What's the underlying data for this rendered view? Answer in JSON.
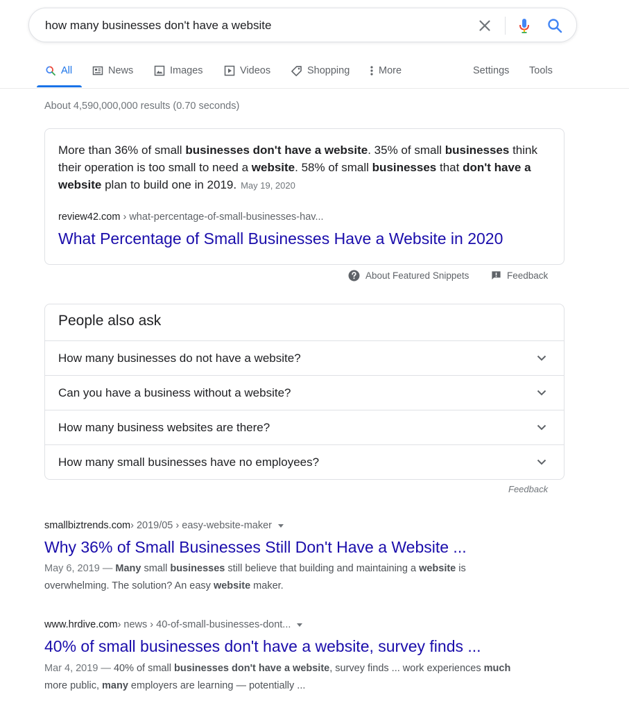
{
  "search": {
    "query": "how many businesses don't have a website"
  },
  "tabs": [
    {
      "label": "All",
      "icon": "search-icon",
      "active": true
    },
    {
      "label": "News",
      "icon": "news-icon"
    },
    {
      "label": "Images",
      "icon": "image-icon"
    },
    {
      "label": "Videos",
      "icon": "video-icon"
    },
    {
      "label": "Shopping",
      "icon": "tag-icon"
    },
    {
      "label": "More",
      "icon": "more-vert-icon"
    }
  ],
  "tools": {
    "settings": "Settings",
    "tools": "Tools"
  },
  "results_stats": "About 4,590,000,000 results (0.70 seconds)",
  "featured_snippet": {
    "s1": "More than 36% of small ",
    "s2": "businesses don't have a website",
    "s3": ". 35% of small ",
    "s4": "businesses",
    "s5": " think their operation is too small to need a ",
    "s6": "website",
    "s7": ". 58% of small ",
    "s8": "businesses",
    "s9": " that ",
    "s10": "don't have a website",
    "s11": " plan to build one in 2019.",
    "date": "May 19, 2020",
    "domain": "review42.com",
    "path": " › what-percentage-of-small-businesses-hav...",
    "title": "What Percentage of Small Businesses Have a Website in 2020"
  },
  "snippet_footer": {
    "about": "About Featured Snippets",
    "feedback": "Feedback"
  },
  "people_also_ask": {
    "title": "People also ask",
    "questions": [
      "How many businesses do not have a website?",
      "Can you have a business without a website?",
      "How many business websites are there?",
      "How many small businesses have no employees?"
    ],
    "feedback": "Feedback"
  },
  "results": [
    {
      "domain": "smallbiztrends.com",
      "path": " › 2019/05 › easy-website-maker",
      "title": "Why 36% of Small Businesses Still Don't Have a Website ...",
      "date": "May 6, 2019 — ",
      "d1": "Many",
      "d2": " small ",
      "d3": "businesses",
      "d4": " still believe that building and maintaining a ",
      "d5": "website",
      "d6": " is overwhelming. The solution? An easy ",
      "d7": "website",
      "d8": " maker."
    },
    {
      "domain": "www.hrdive.com",
      "path": " › news › 40-of-small-businesses-dont...",
      "title": "40% of small businesses don't have a website, survey finds ...",
      "date": "Mar 4, 2019 — ",
      "d1": "40% of small ",
      "d2": "businesses don't have a website",
      "d3": ", survey finds ... work experiences ",
      "d4": "much",
      "d5": " more public, ",
      "d6": "many",
      "d7": " employers are learning — potentially ..."
    }
  ],
  "colors": {
    "link": "#1a0dab",
    "accent": "#1a73e8",
    "muted": "#70757a",
    "border": "#dfe1e5"
  }
}
